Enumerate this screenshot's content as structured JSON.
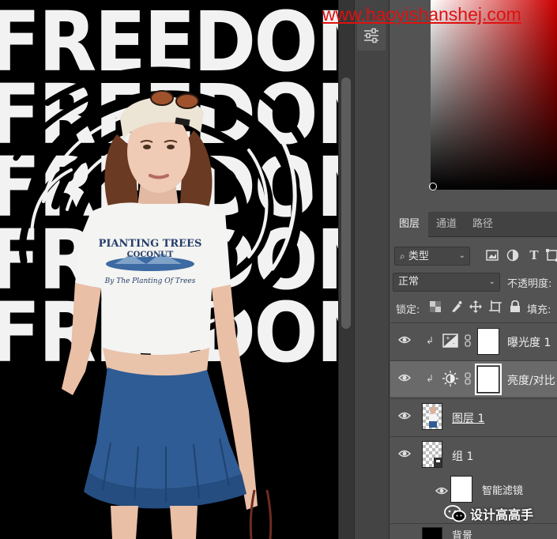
{
  "canvas": {
    "text_lines": [
      "FREEDOM",
      "FREEDOM",
      "FREEDOM",
      "FREEDOM",
      "FREEDOM"
    ],
    "tshirt_lines": [
      "PIANTING TREES",
      "COCONUT",
      "By The Planting Of Trees"
    ]
  },
  "watermark": "www.haoyishanshej.com",
  "layers_panel": {
    "tabs": [
      {
        "label": "图层",
        "active": true
      },
      {
        "label": "通道",
        "active": false
      },
      {
        "label": "路径",
        "active": false
      }
    ],
    "filter": {
      "label": "类型"
    },
    "blend_mode": "正常",
    "opacity_label": "不透明度:",
    "lock_label": "锁定:",
    "fill_label": "填充:",
    "layers": [
      {
        "name": "曝光度 1",
        "type": "exposure-adjustment",
        "clipped": true,
        "selected": false
      },
      {
        "name": "亮度/对比",
        "type": "brightness-contrast-adjustment",
        "clipped": true,
        "selected": true
      },
      {
        "name": "图层 1",
        "type": "pixel",
        "clipped": false,
        "selected": false
      },
      {
        "name": "组 1",
        "type": "group",
        "clipped": false,
        "selected": false
      },
      {
        "name": "智能滤镜",
        "type": "smart-filters",
        "clipped": false,
        "selected": false
      },
      {
        "name": "背景",
        "type": "background",
        "clipped": false,
        "selected": false
      }
    ]
  },
  "social_watermark": {
    "icon": "wechat-icon",
    "text": "设计高高手"
  },
  "colors": {
    "panel_bg": "#535353",
    "tab_bar": "#424242",
    "selected_row": "#6a6a6a",
    "watermark_red": "#e01010",
    "picker_hue": "#cc0000"
  }
}
